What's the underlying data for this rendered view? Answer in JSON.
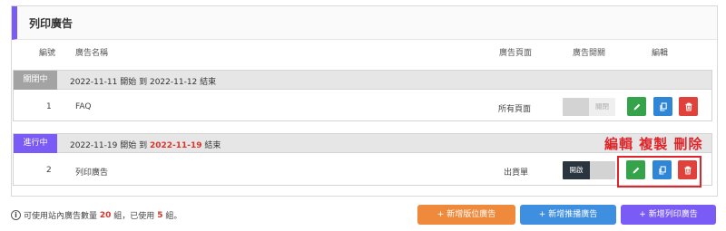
{
  "panel": {
    "title": "列印廣告"
  },
  "columns": {
    "number": "編號",
    "name": "廣告名稱",
    "page": "廣告頁面",
    "switch": "廣告開關",
    "edit": "編輯"
  },
  "rows": [
    {
      "status": "關閉中",
      "date_start": "2022-11-11",
      "word_start": "開始",
      "word_to": "到",
      "date_end": "2022-11-12",
      "word_end": "結束",
      "number": "1",
      "name": "FAQ",
      "page": "所有頁面",
      "toggle_label": "關閉"
    },
    {
      "status": "進行中",
      "date_start": "2022-11-19",
      "word_start": "開始",
      "word_to": "到",
      "date_end": "2022-11-19",
      "word_end": "結束",
      "number": "2",
      "name": "列印廣告",
      "page": "出貨單",
      "toggle_label": "開啟"
    }
  ],
  "annotation": {
    "label": "編輯 複製 刪除"
  },
  "footer": {
    "prefix": "可使用站內廣告數量",
    "total": "20",
    "middle": "組，已使用",
    "used": "5",
    "suffix": "組。"
  },
  "buttons": {
    "add_banner": "+ 新增版位廣告",
    "add_push": "+ 新增推播廣告",
    "add_print": "+ 新增列印廣告"
  },
  "colors": {
    "accent": "#7a5bf5",
    "status_closed": "#a3a3a3",
    "status_active": "#7a5bf5",
    "edit": "#35a34a",
    "copy": "#2f86d6",
    "delete": "#e0413a",
    "orange": "#ef8a3c",
    "blue": "#3f8fe0",
    "purple": "#7a5bf5",
    "annotation": "#e0252a"
  },
  "icons": {
    "edit": "pencil-icon",
    "copy": "copy-icon",
    "delete": "trash-icon",
    "info": "info-icon"
  }
}
